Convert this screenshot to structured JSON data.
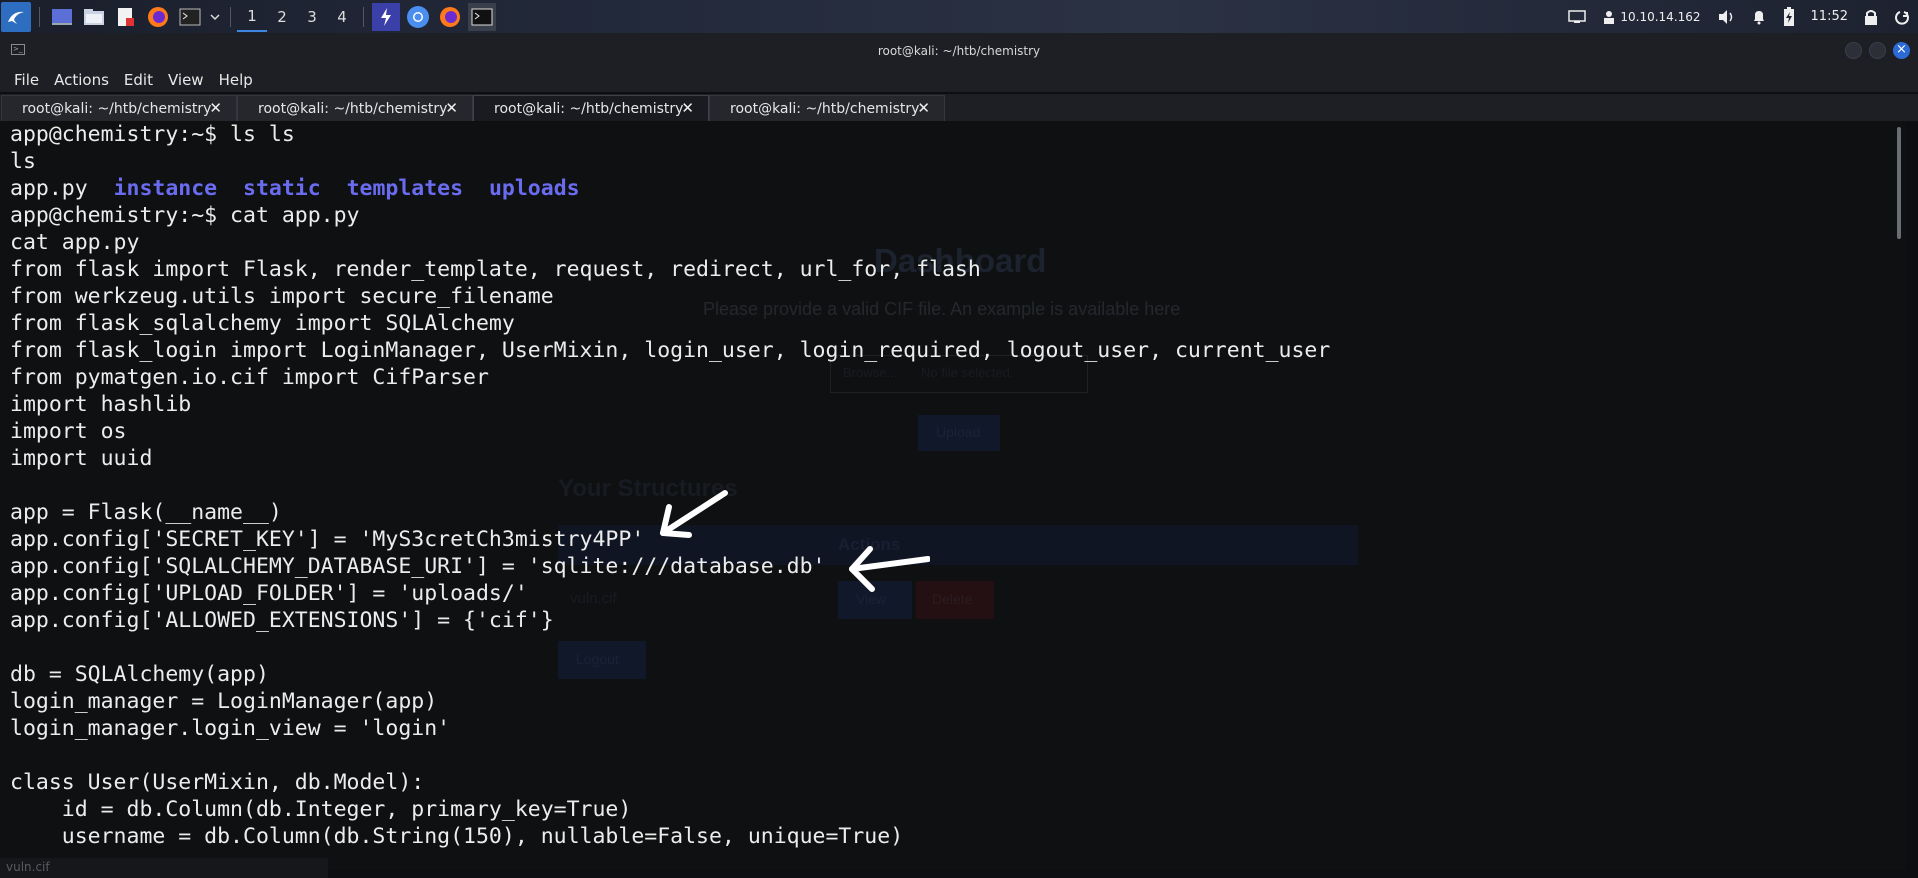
{
  "panel": {
    "workspaces": [
      "1",
      "2",
      "3",
      "4"
    ],
    "active_workspace": "1",
    "launcher_icons": [
      "kali-menu-icon",
      "desktop-icon",
      "file-manager-icon",
      "text-editor-icon",
      "firefox-icon",
      "terminal-icon"
    ],
    "task_icons": [
      "burp-icon",
      "chromium-icon",
      "firefox-icon",
      "terminal-icon"
    ],
    "ip_address": "10.10.14.162",
    "clock": "11:52"
  },
  "window": {
    "title": "root@kali: ~/htb/chemistry"
  },
  "menubar": {
    "items": [
      "File",
      "Actions",
      "Edit",
      "View",
      "Help"
    ]
  },
  "tabs": [
    {
      "label": "root@kali: ~/htb/chemistry",
      "active": false
    },
    {
      "label": "root@kali: ~/htb/chemistry",
      "active": false
    },
    {
      "label": "root@kali: ~/htb/chemistry",
      "active": true
    },
    {
      "label": "root@kali: ~/htb/chemistry",
      "active": false
    }
  ],
  "terminal": {
    "lines": [
      "app@chemistry:~$ ls ls",
      "ls",
      "",
      "app@chemistry:~$ cat app.py",
      "cat app.py",
      "from flask import Flask, render_template, request, redirect, url_for, flash",
      "from werkzeug.utils import secure_filename",
      "from flask_sqlalchemy import SQLAlchemy",
      "from flask_login import LoginManager, UserMixin, login_user, login_required, logout_user, current_user",
      "from pymatgen.io.cif import CifParser",
      "import hashlib",
      "import os",
      "import uuid",
      "",
      "app = Flask(__name__)",
      "app.config['SECRET_KEY'] = 'MyS3cretCh3mistry4PP'",
      "app.config['SQLALCHEMY_DATABASE_URI'] = 'sqlite:///database.db'",
      "app.config['UPLOAD_FOLDER'] = 'uploads/'",
      "app.config['ALLOWED_EXTENSIONS'] = {'cif'}",
      "",
      "db = SQLAlchemy(app)",
      "login_manager = LoginManager(app)",
      "login_manager.login_view = 'login'",
      "",
      "class User(UserMixin, db.Model):",
      "    id = db.Column(db.Integer, primary_key=True)",
      "    username = db.Column(db.String(150), nullable=False, unique=True)"
    ],
    "ls_output": {
      "file": "app.py",
      "dirs": [
        "instance",
        "static",
        "templates",
        "uploads"
      ]
    }
  },
  "background_page": {
    "heading": "Dashboard",
    "subtitle": "Please provide a valid CIF file. An example is available here",
    "browse": "Browse...",
    "no_file": "No file selected.",
    "upload": "Upload",
    "section": "Your Structures",
    "col_action": "Actions",
    "file": "vuln.cif",
    "view": "View",
    "delete": "Delete",
    "logout": "Logout"
  },
  "statusbar": {
    "text": "vuln.cif"
  },
  "colors": {
    "terminal_bg": "#0f1012",
    "terminal_fg": "#ececec",
    "directory": "#6a6cf0",
    "accent": "#2c6bd6"
  }
}
